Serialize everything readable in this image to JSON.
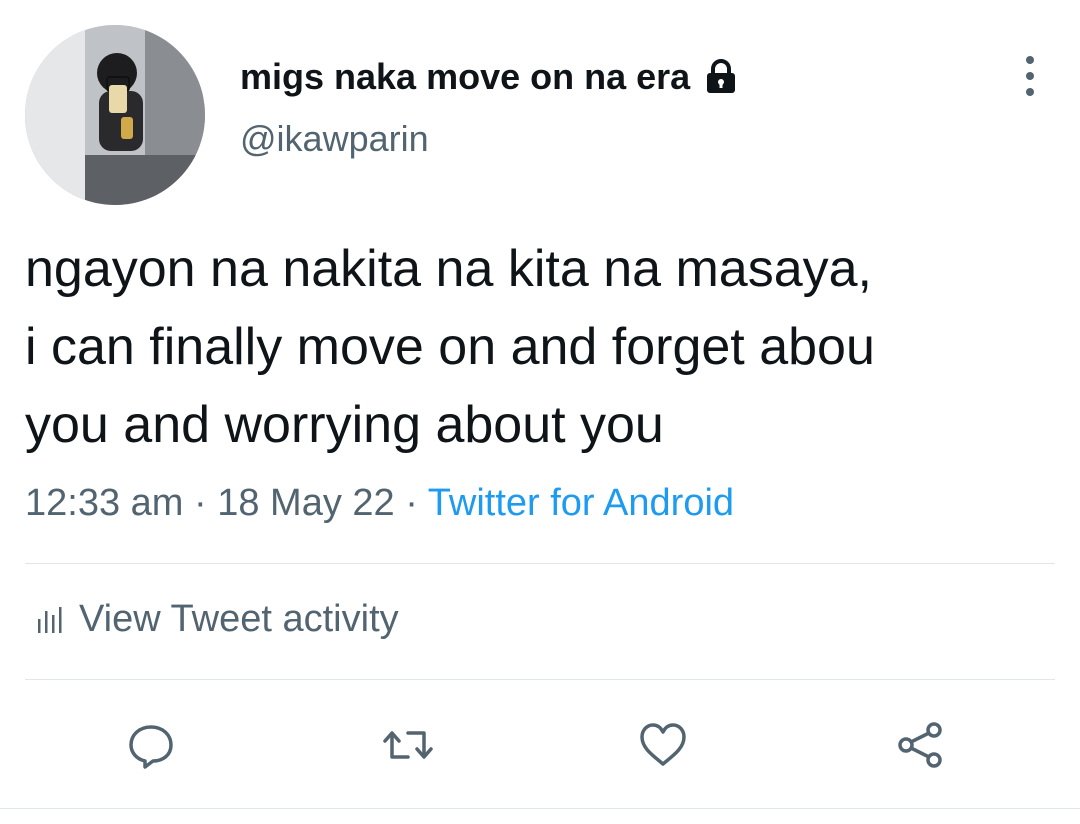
{
  "author": {
    "display_name": "migs naka move on na era",
    "handle": "@ikawparin",
    "avatar_icon": "avatar-photo",
    "protected_icon": "lock-icon"
  },
  "tweet": {
    "text_lines": [
      "ngayon na nakita na kita na masaya,",
      "i can finally move on and forget abou",
      "you and worrying about you"
    ],
    "time": "12:33 am",
    "date": "18 May 22",
    "separator": "·",
    "source": "Twitter for Android"
  },
  "activity": {
    "label": "View Tweet activity",
    "icon": "bar-chart-icon"
  },
  "actions": [
    {
      "name": "reply",
      "icon": "reply-icon"
    },
    {
      "name": "retweet",
      "icon": "retweet-icon"
    },
    {
      "name": "like",
      "icon": "heart-icon"
    },
    {
      "name": "share",
      "icon": "share-icon"
    }
  ],
  "colors": {
    "text": "#0f1419",
    "secondary": "#536471",
    "link": "#1d9bf0",
    "divider": "#e1e6ea"
  }
}
